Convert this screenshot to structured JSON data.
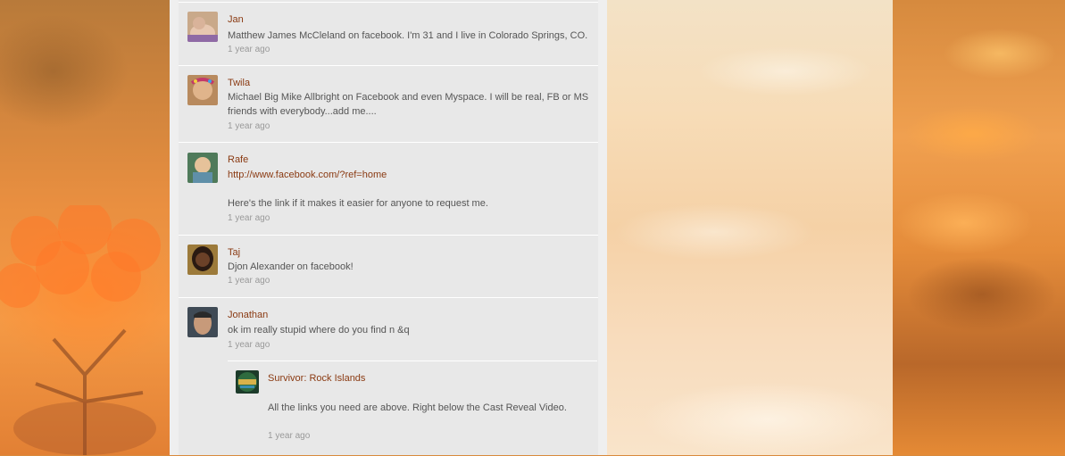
{
  "comments": [
    {
      "name": "Jan",
      "avatar_icon": "user-avatar-jan",
      "lines": [
        "Matthew James McCleland on facebook. I'm 31 and I live in Colorado Springs, CO."
      ],
      "time": "1 year ago"
    },
    {
      "name": "Twila",
      "avatar_icon": "user-avatar-twila",
      "lines": [
        "Michael Big Mike Allbright on Facebook and even Myspace.  I will be real, FB or MS",
        "friends with everybody...add me...."
      ],
      "time": "1 year ago"
    },
    {
      "name": "Rafe",
      "avatar_icon": "user-avatar-rafe",
      "link": "http://www.facebook.com/?ref=home",
      "lines": [
        "Here's the link if it makes it easier for anyone to request me."
      ],
      "time": "1 year ago"
    },
    {
      "name": "Taj",
      "avatar_icon": "user-avatar-taj",
      "lines": [
        "Djon Alexander on facebook!"
      ],
      "time": "1 year ago"
    },
    {
      "name": "Jonathan",
      "avatar_icon": "user-avatar-jonathan",
      "lines": [
        "ok im really stupid where do you find n &q"
      ],
      "time": "1 year ago"
    }
  ],
  "reply": {
    "name": "Survivor: Rock Islands",
    "avatar_icon": "survivor-logo-icon",
    "text": "All the links you need are above.   Right below the Cast Reveal Video.",
    "time": "1 year ago"
  },
  "colors": {
    "name_link": "#8a3a12",
    "body_text": "#555555",
    "timestamp": "#999999",
    "feed_bg": "#e8e8e8"
  }
}
